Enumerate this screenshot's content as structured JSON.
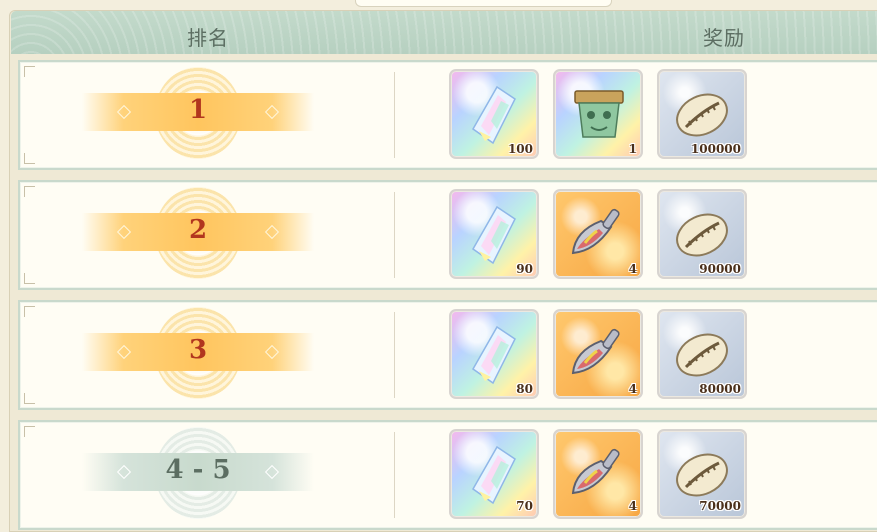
{
  "header": {
    "rank_label": "排名",
    "reward_label": "奖励"
  },
  "rows": [
    {
      "rank": "1",
      "rank_style": "gold",
      "rewards": [
        {
          "item": "rainbow-crystal-icon",
          "qty": "100"
        },
        {
          "item": "bronze-ding-icon",
          "qty": "1"
        },
        {
          "item": "cowrie-shell-icon",
          "qty": "100000"
        }
      ]
    },
    {
      "rank": "2",
      "rank_style": "gold",
      "rewards": [
        {
          "item": "rainbow-crystal-icon",
          "qty": "90"
        },
        {
          "item": "scoop-icon",
          "qty": "4"
        },
        {
          "item": "cowrie-shell-icon",
          "qty": "90000"
        }
      ]
    },
    {
      "rank": "3",
      "rank_style": "gold",
      "rewards": [
        {
          "item": "rainbow-crystal-icon",
          "qty": "80"
        },
        {
          "item": "scoop-icon",
          "qty": "4"
        },
        {
          "item": "cowrie-shell-icon",
          "qty": "80000"
        }
      ]
    },
    {
      "rank": "4 - 5",
      "rank_style": "grey",
      "rewards": [
        {
          "item": "rainbow-crystal-icon",
          "qty": "70"
        },
        {
          "item": "scoop-icon",
          "qty": "4"
        },
        {
          "item": "cowrie-shell-icon",
          "qty": "70000"
        }
      ]
    }
  ],
  "colors": {
    "header_bg": "#b6d0c0",
    "row_bg": "#fffdf4",
    "rank_text": "#b2361e",
    "rank_text_grey": "#5c6e62"
  }
}
